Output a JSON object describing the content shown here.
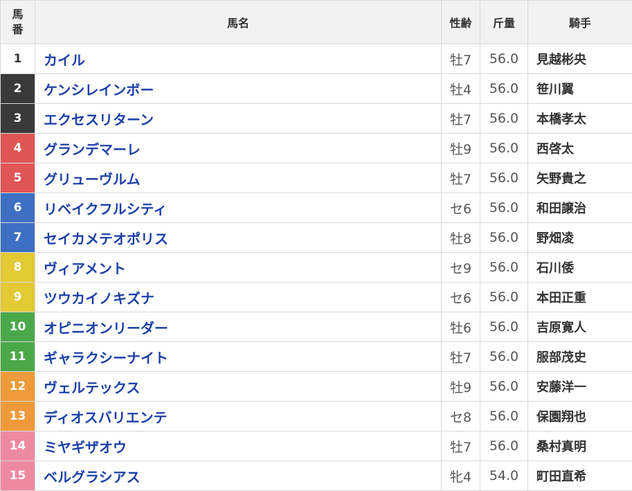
{
  "header": {
    "num_line1": "馬",
    "num_line2": "番",
    "name": "馬名",
    "sex_age": "性齢",
    "weight": "斤量",
    "jockey": "騎手"
  },
  "gate_colors": {
    "1": {
      "bg": "#ffffff",
      "fg": "#333333"
    },
    "2": {
      "bg": "#3a3a3a",
      "fg": "#ffffff"
    },
    "3": {
      "bg": "#e05555",
      "fg": "#ffffff"
    },
    "4": {
      "bg": "#3f6fc2",
      "fg": "#ffffff"
    },
    "5": {
      "bg": "#e3c934",
      "fg": "#ffffff"
    },
    "6": {
      "bg": "#4aa84a",
      "fg": "#ffffff"
    },
    "7": {
      "bg": "#ee9a3a",
      "fg": "#ffffff"
    },
    "8": {
      "bg": "#ee8aa0",
      "fg": "#ffffff"
    }
  },
  "rows": [
    {
      "num": "1",
      "gate": "1",
      "name": "カイル",
      "sex_age": "牡7",
      "weight": "56.0",
      "jockey": "見越彬央"
    },
    {
      "num": "2",
      "gate": "2",
      "name": "ケンシレインボー",
      "sex_age": "牡4",
      "weight": "56.0",
      "jockey": "笹川翼"
    },
    {
      "num": "3",
      "gate": "2",
      "name": "エクセスリターン",
      "sex_age": "牡7",
      "weight": "56.0",
      "jockey": "本橋孝太"
    },
    {
      "num": "4",
      "gate": "3",
      "name": "グランデマーレ",
      "sex_age": "牡9",
      "weight": "56.0",
      "jockey": "西啓太"
    },
    {
      "num": "5",
      "gate": "3",
      "name": "グリューヴルム",
      "sex_age": "牡7",
      "weight": "56.0",
      "jockey": "矢野貴之"
    },
    {
      "num": "6",
      "gate": "4",
      "name": "リベイクフルシティ",
      "sex_age": "セ6",
      "weight": "56.0",
      "jockey": "和田譲治"
    },
    {
      "num": "7",
      "gate": "4",
      "name": "セイカメテオポリス",
      "sex_age": "牡8",
      "weight": "56.0",
      "jockey": "野畑凌"
    },
    {
      "num": "8",
      "gate": "5",
      "name": "ヴィアメント",
      "sex_age": "セ9",
      "weight": "56.0",
      "jockey": "石川倭"
    },
    {
      "num": "9",
      "gate": "5",
      "name": "ツウカイノキズナ",
      "sex_age": "セ6",
      "weight": "56.0",
      "jockey": "本田正重"
    },
    {
      "num": "10",
      "gate": "6",
      "name": "オピニオンリーダー",
      "sex_age": "牡6",
      "weight": "56.0",
      "jockey": "吉原寛人"
    },
    {
      "num": "11",
      "gate": "6",
      "name": "ギャラクシーナイト",
      "sex_age": "牡7",
      "weight": "56.0",
      "jockey": "服部茂史"
    },
    {
      "num": "12",
      "gate": "7",
      "name": "ヴェルテックス",
      "sex_age": "牡9",
      "weight": "56.0",
      "jockey": "安藤洋一"
    },
    {
      "num": "13",
      "gate": "7",
      "name": "ディオスバリエンテ",
      "sex_age": "セ8",
      "weight": "56.0",
      "jockey": "保園翔也"
    },
    {
      "num": "14",
      "gate": "8",
      "name": "ミヤギザオウ",
      "sex_age": "牡7",
      "weight": "56.0",
      "jockey": "桑村真明"
    },
    {
      "num": "15",
      "gate": "8",
      "name": "ベルグラシアス",
      "sex_age": "牝4",
      "weight": "54.0",
      "jockey": "町田直希"
    }
  ]
}
